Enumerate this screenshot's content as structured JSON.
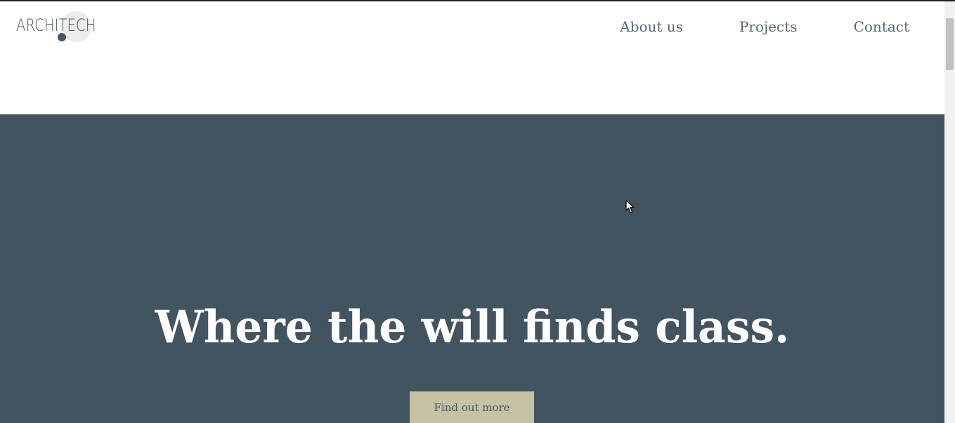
{
  "brand": {
    "logo_text": "ARCHITECH"
  },
  "nav": {
    "items": [
      {
        "label": "About us"
      },
      {
        "label": "Projects"
      },
      {
        "label": "Contact"
      }
    ]
  },
  "hero": {
    "title": "Where the will finds class.",
    "cta_label": "Find out more"
  },
  "colors": {
    "hero_bg": "#435461",
    "cta_bg": "#c7c2a4",
    "nav_text": "#5a6673",
    "header_bg": "#ffffff"
  },
  "icons": {
    "cursor": "mouse-pointer-icon"
  }
}
